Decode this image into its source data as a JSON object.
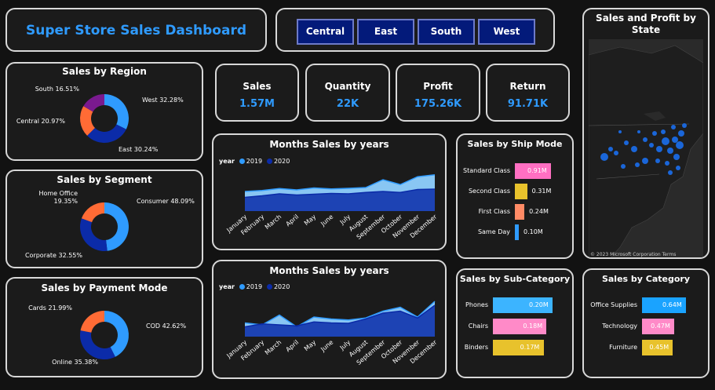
{
  "dashboard": {
    "title": "Super Store Sales Dashboard"
  },
  "region_filter": {
    "buttons": [
      "Central",
      "East",
      "South",
      "West"
    ]
  },
  "kpis": [
    {
      "title": "Sales",
      "value": "1.57M"
    },
    {
      "title": "Quantity",
      "value": "22K"
    },
    {
      "title": "Profit",
      "value": "175.26K"
    },
    {
      "title": "Return",
      "value": "91.71K"
    }
  ],
  "map": {
    "title": "Sales and Profit by State",
    "credit": "© 2023 Microsoft Corporation  Terms"
  },
  "colors": {
    "accent": "#2f9bff",
    "blue_dark": "#0b2ba8",
    "orange": "#ff6b35",
    "purple": "#7a1a8f",
    "pink": "#ff8ac8",
    "yellow": "#e8c22c",
    "light_blue": "#3cb4ff",
    "salmon": "#ff8a65"
  },
  "chart_data": [
    {
      "id": "region",
      "type": "pie",
      "title": "Sales by Region",
      "labels": [
        "West 32.28%",
        "East 30.24%",
        "Central 20.97%",
        "South 16.51%"
      ],
      "values": [
        32.28,
        30.24,
        20.97,
        16.51
      ],
      "colors": [
        "#2f9bff",
        "#0b2ba8",
        "#ff6b35",
        "#7a1a8f"
      ]
    },
    {
      "id": "segment",
      "type": "pie",
      "title": "Sales by Segment",
      "labels": [
        "Consumer 48.09%",
        "Corporate 32.55%",
        "Home Office 19.35%"
      ],
      "values": [
        48.09,
        32.55,
        19.35
      ],
      "colors": [
        "#2f9bff",
        "#0b2ba8",
        "#ff6b35"
      ]
    },
    {
      "id": "payment",
      "type": "pie",
      "title": "Sales by Payment Mode",
      "labels": [
        "COD 42.62%",
        "Online 35.38%",
        "Cards 21.99%"
      ],
      "values": [
        42.62,
        35.38,
        21.99
      ],
      "colors": [
        "#2f9bff",
        "#0b2ba8",
        "#ff6b35"
      ]
    },
    {
      "id": "months1",
      "type": "area",
      "title": "Months Sales by years",
      "legend_title": "year",
      "categories": [
        "January",
        "February",
        "March",
        "April",
        "May",
        "June",
        "July",
        "August",
        "September",
        "October",
        "November",
        "December"
      ],
      "series": [
        {
          "name": "2019",
          "color": "#8fd0ff",
          "values": [
            100,
            105,
            115,
            108,
            118,
            113,
            116,
            120,
            160,
            135,
            175,
            185
          ]
        },
        {
          "name": "2020",
          "color": "#0b2ba8",
          "values": [
            70,
            78,
            88,
            82,
            86,
            90,
            88,
            95,
            100,
            95,
            110,
            112
          ]
        }
      ]
    },
    {
      "id": "months2",
      "type": "area",
      "title": "Months Sales by years",
      "legend_title": "year",
      "categories": [
        "January",
        "February",
        "March",
        "April",
        "May",
        "June",
        "July",
        "August",
        "September",
        "October",
        "November",
        "December"
      ],
      "series": [
        {
          "name": "2019",
          "color": "#8fd0ff",
          "values": [
            70,
            60,
            110,
            50,
            100,
            90,
            85,
            95,
            130,
            150,
            100,
            180
          ]
        },
        {
          "name": "2020",
          "color": "#0b2ba8",
          "values": [
            50,
            65,
            60,
            55,
            75,
            70,
            68,
            90,
            120,
            130,
            95,
            160
          ]
        }
      ]
    },
    {
      "id": "shipmode",
      "type": "bar",
      "title": "Sales by Ship Mode",
      "categories": [
        "Standard Class",
        "Second Class",
        "First Class",
        "Same Day"
      ],
      "values": [
        0.91,
        0.31,
        0.24,
        0.1
      ],
      "labels": [
        "0.91M",
        "0.31M",
        "0.24M",
        "0.10M"
      ],
      "colors": [
        "#ff6fc2",
        "#e8c22c",
        "#ff8a65",
        "#2f9bff"
      ]
    },
    {
      "id": "subcat",
      "type": "bar",
      "title": "Sales by Sub-Category",
      "categories": [
        "Phones",
        "Chairs",
        "Binders"
      ],
      "values": [
        0.2,
        0.18,
        0.17
      ],
      "labels": [
        "0.20M",
        "0.18M",
        "0.17M"
      ],
      "colors": [
        "#3cb4ff",
        "#ff8ac8",
        "#e8c22c"
      ]
    },
    {
      "id": "category",
      "type": "bar",
      "title": "Sales by Category",
      "categories": [
        "Office Supplies",
        "Technology",
        "Furniture"
      ],
      "values": [
        0.64,
        0.47,
        0.45
      ],
      "labels": [
        "0.64M",
        "0.47M",
        "0.45M"
      ],
      "colors": [
        "#1aa3ff",
        "#ff8ac8",
        "#e8c22c"
      ]
    }
  ]
}
